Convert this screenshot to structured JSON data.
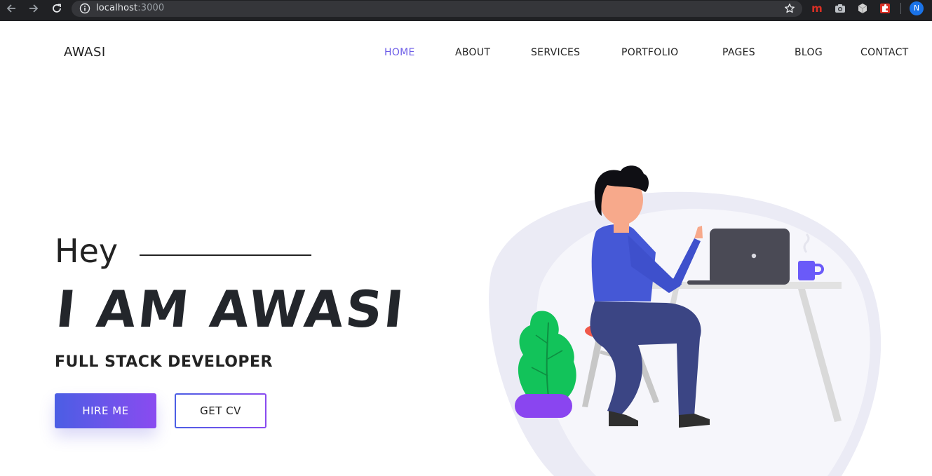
{
  "browser": {
    "url_host": "localhost",
    "url_port": ":3000",
    "extensions": [
      "m-icon",
      "camera-icon",
      "cube-icon",
      "puzzle-icon"
    ],
    "profile_initial": "N"
  },
  "site": {
    "brand": "AWASI",
    "nav": [
      {
        "label": "HOME",
        "active": true
      },
      {
        "label": "ABOUT",
        "active": false
      },
      {
        "label": "SERVICES",
        "active": false
      },
      {
        "label": "PORTFOLIO",
        "active": false
      },
      {
        "label": "PAGES",
        "active": false
      },
      {
        "label": "BLOG",
        "active": false
      },
      {
        "label": "CONTACT",
        "active": false
      }
    ]
  },
  "hero": {
    "greeting": "Hey",
    "title": "I AM AWASI",
    "subtitle": "FULL STACK DEVELOPER",
    "primary_button": "HIRE ME",
    "secondary_button": "GET CV"
  },
  "colors": {
    "accent": "#6c5ce7",
    "gradient_start": "#4b5ee4",
    "gradient_end": "#8a4bf0",
    "text_dark": "#222222",
    "chrome_bg": "#202124"
  }
}
